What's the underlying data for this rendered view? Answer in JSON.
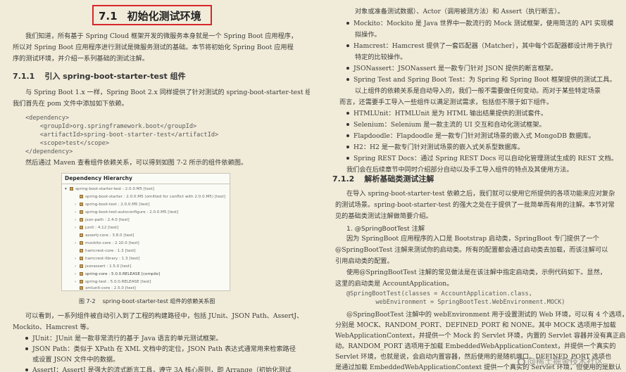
{
  "left_page": {
    "chapter_number": "7.1",
    "chapter_title": "初始化测试环境",
    "intro": [
      "我们知道，所有基于 Spring Cloud 框架开发的微服务本身就是一个 Spring Boot 应用程序，",
      "所以对 Spring Boot 应用程序进行测试是微服务测试的基础。本节将初始化 Spring Boot 应用程",
      "序的测试环境，并介绍一系列基础的测试注解。"
    ],
    "section_number": "7.1.1",
    "section_title": "引入 spring-boot-starter-test 组件",
    "section_text": [
      "与 Spring Boot 1.x 一样，Spring Boot 2.x 同样提供了针对测试的 spring-boot-starter-test 组件。",
      "我们首先在 pom 文件中添加如下依赖。"
    ],
    "code": [
      "<dependency>",
      "    <groupId>org.springframework.boot</groupId>",
      "    <artifactId>spring-boot-starter-test</artifactId>",
      "    <scope>test</scope>",
      "</dependency>"
    ],
    "after_code": "然后通过 Maven 查看组件依赖关系，可以得到如图 7-2 所示的组件依赖图。",
    "figure": {
      "title": "Dependency Hierarchy",
      "rows": [
        "spring-boot-starter-test : 2.0.0.M5 [test]",
        "spring-boot-starter : 2.0.0.M5 (omitted for conflict with 2.0.0.M5) [test]",
        "spring-boot-test : 2.0.0.M5 [test]",
        "spring-boot-test-autoconfigure : 2.0.0.M5 [test]",
        "json-path : 2.4.0 [test]",
        "junit : 4.12 [test]",
        "assertj-core : 3.8.0 [test]",
        "mockito-core : 2.10.0 [test]",
        "hamcrest-core : 1.3 [test]",
        "hamcrest-library : 1.3 [test]",
        "jsonassert : 1.5.0 [test]",
        "spring-core : 5.0.0.RELEASE [compile]",
        "spring-test : 5.0.0.RELEASE [test]",
        "xmlunit-core : 2.5.0 [test]"
      ]
    },
    "caption_number": "图 7-2",
    "caption_text": "spring-boot-starter-test 组件的依赖关系图",
    "after_figure": [
      "可以看到，一系列组件被自动引入到了工程的构建路径中，包括 JUnit、JSON Path、AssertJ、",
      "Mockito、Hamcrest 等。"
    ],
    "bullets": [
      "JUnit：JUnit 是一款非常流行的基于 Java 语言的单元测试框架。",
      "JSON Path：类似于 XPath 在 XML 文档中的定位，JSON Path 表达式通常用来检索路径",
      "或设置 JSON 文件中的数据。",
      "AssertJ：AssertJ 是强大的流式断言工具，遵守 3A 核心原则，即 Arrange（初始化测试"
    ]
  },
  "right_page": {
    "top_lines": [
      "对象或准备测试数据）、Actor（调用被测方法）和 Assert（执行断言）。"
    ],
    "bullets1": [
      "Mockito：Mockito 是 Java 世界中一款流行的 Mock 测试框架，使用简洁的 API 实现模",
      "拟操作。",
      "Hamcrest：Hamcrest 提供了一套匹配器（Matcher），其中每个匹配器都设计用于执行",
      "特定的比较操作。",
      "JSONassert：JSONassert 是一款专门针对 JSON 提供的断言框架。",
      "Spring Test and Spring Boot Test：为 Spring 和 Spring Boot 框架提供的测试工具。"
    ],
    "mid_text": [
      "以上组件的依赖关系是自动导入的，我们一般不需要做任何变动。而对于某些特定场景",
      "而言，还需要手工导入一些组件以满足测试需求，包括但不限于如下组件。"
    ],
    "bullets2": [
      "HTMLUnit：HTMLUnit 是为 HTML 输出结果提供的测试套件。",
      "Selenium：Selenium 是一款主流的 UI 交互和自动化测试框架。",
      "Flapdoodle：Flapdoodle 是一款专门针对测试场景的嵌入式 MongoDB 数据库。",
      "H2：H2 是一款专门针对测试场景的嵌入式关系型数据库。",
      "Spring REST Docs：通过 Spring REST Docs 可以自动化管理测试生成的 REST 文档。"
    ],
    "end_text": "我们会在后续章节中同时介绍部分自动以及手工导入组件的特点及其使用方法。",
    "section_number": "7.1.2",
    "section_title": "解析基础类测试注解",
    "section_text": [
      "在导入 spring-boot-starter-test 依赖之后，我们就可以使用它所提供的各项功能来应对复杂",
      "的测试场景。spring-boot-starter-test 的强大之处在于提供了一批简单而有用的注解。本节对常",
      "见的基础类测试注解做简要介绍。"
    ],
    "sub_heading": "1. @SpringBootTest 注解",
    "sub_text": [
      "因为 SpringBoot 应用程序的入口是 Bootstrap 启动类，SpringBoot 专门提供了一个",
      "@SpringBootTest 注解来测试你的启动类。所有的配置都会通过启动类去加载，而该注解可以",
      "引用启动类的配置。",
      "使用@SpringBootTest 注解的常见做法是在该注解中指定启动类，示例代码如下。显然，",
      "这里的启动类是 AccountApplication。"
    ],
    "code": [
      "@SpringBootTest(classes = AccountApplication.class,",
      "        webEnvironment = SpringBootTest.WebEnvironment.MOCK)"
    ],
    "after_code": [
      "@SpringBootTest 注解中的 webEnvironment 用于设置测试的 Web 环境，可以有 4 个选项，",
      "分别是 MOCK、RANDOM_PORT、DEFINED_PORT 和 NONE。其中 MOCK 选项用于加载",
      "WebApplicationContext，并提供一个 Mock 的 Servlet 环境，内置的 Servlet 容器并没有真正启",
      "动。RANDOM_PORT 选项用于加载 EmbeddedWebApplicationContext，并提供一个真实的",
      "Servlet 环境，也就是说，会启动内置容器，然后使用的是随机端口。DEFINED_PORT 选项也",
      "是通过加载 EmbeddedWebApplicationContext 提供一个真实的 Servlet 环境，但使用的是默认"
    ],
    "watermark": "@稀土掘金技术社区"
  },
  "colors": {
    "paper": "#f1ecda",
    "highlight_box": "#d8252b",
    "text": "#3b3a36"
  }
}
